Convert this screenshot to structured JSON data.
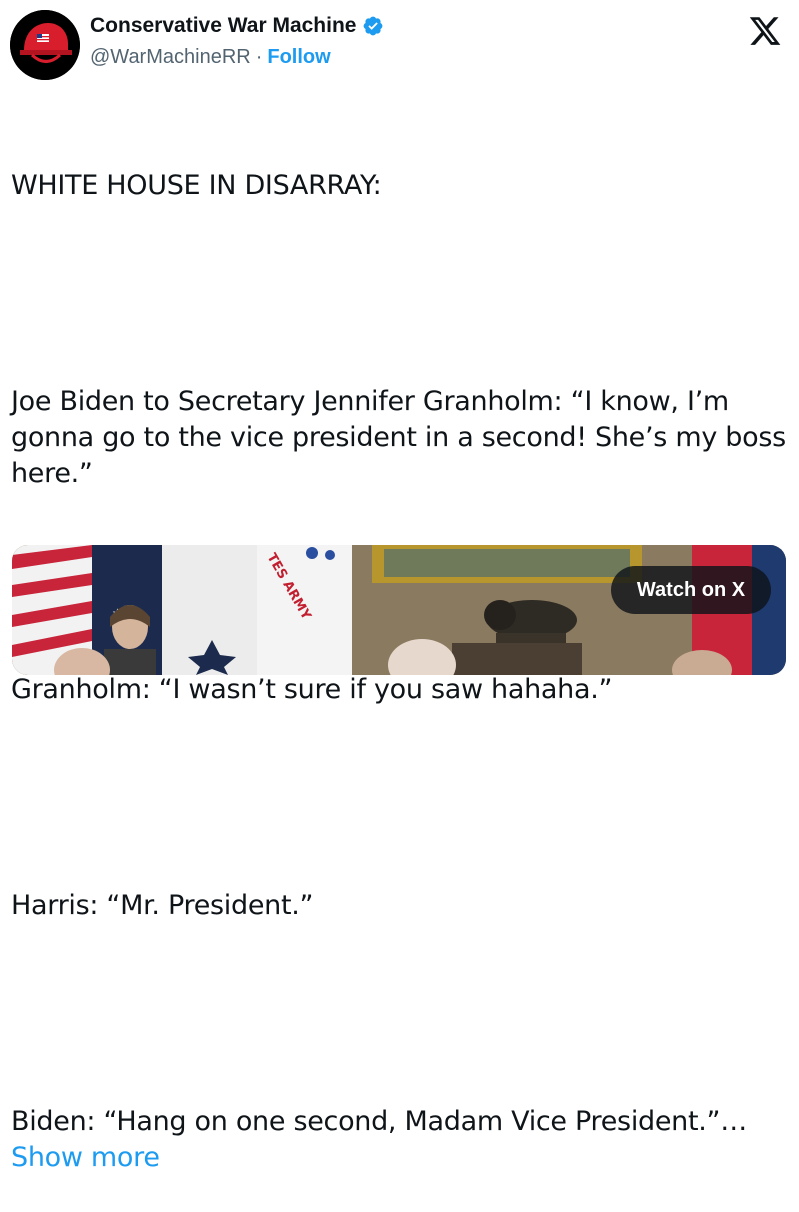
{
  "author": {
    "display_name": "Conservative War Machine",
    "handle": "@WarMachineRR",
    "separator": "·",
    "follow_label": "Follow",
    "avatar_icon": "red-helmet-icon",
    "verified_icon": "verified-badge-icon"
  },
  "brand": {
    "logo_icon": "x-logo-icon"
  },
  "tweet": {
    "line1": "WHITE HOUSE IN DISARRAY:",
    "para2": "Joe Biden to Secretary Jennifer Granholm: “I know, I’m gonna go to the vice president in a second! She’s my boss here.”",
    "para3": "Granholm: “I wasn’t sure if you saw hahaha.”",
    "para4": "Harris: “Mr. President.”",
    "para5": "Biden: “Hang on one second, Madam Vice President.”…",
    "show_more": "Show more"
  },
  "media": {
    "watch_label": "Watch on X",
    "flag_text": "TES ARMY"
  },
  "colors": {
    "accent": "#1d9bf0",
    "text": "#0f1419",
    "secondary": "#536471",
    "helmet_red": "#d81e2c"
  }
}
